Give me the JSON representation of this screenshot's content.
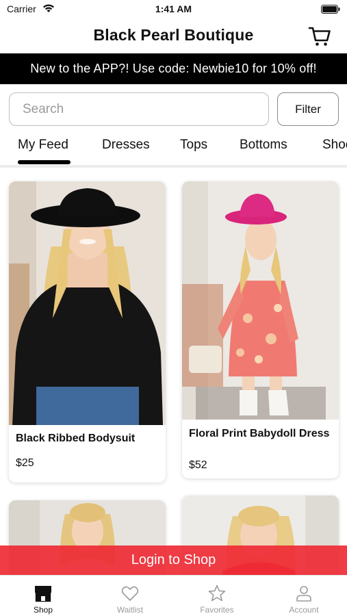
{
  "status_bar": {
    "carrier": "Carrier",
    "time": "1:41 AM"
  },
  "header": {
    "title": "Black Pearl Boutique",
    "cart_icon": "cart-icon"
  },
  "promo": {
    "text": "New to the APP?! Use code: Newbie10 for 10% off!"
  },
  "search": {
    "placeholder": "Search",
    "value": ""
  },
  "filter": {
    "label": "Filter"
  },
  "tabs": [
    {
      "label": "My Feed",
      "active": true
    },
    {
      "label": "Dresses"
    },
    {
      "label": "Tops"
    },
    {
      "label": "Bottoms"
    },
    {
      "label": "Shoes"
    }
  ],
  "products": [
    {
      "name": "Black Ribbed Bodysuit",
      "price": "$25"
    },
    {
      "name": "Floral Print Babydoll Dress",
      "price": "$52"
    },
    {
      "name": "",
      "price": ""
    },
    {
      "name": "",
      "price": ""
    }
  ],
  "login_banner": {
    "label": "Login to Shop"
  },
  "bottom_nav": [
    {
      "label": "Shop",
      "icon": "store-icon",
      "active": true
    },
    {
      "label": "Waitlist",
      "icon": "heart-icon"
    },
    {
      "label": "Favorites",
      "icon": "star-icon"
    },
    {
      "label": "Account",
      "icon": "person-icon"
    }
  ],
  "colors": {
    "accent_red": "#EE2B35",
    "banner_black": "#000000",
    "active_indicator": "#000000"
  }
}
